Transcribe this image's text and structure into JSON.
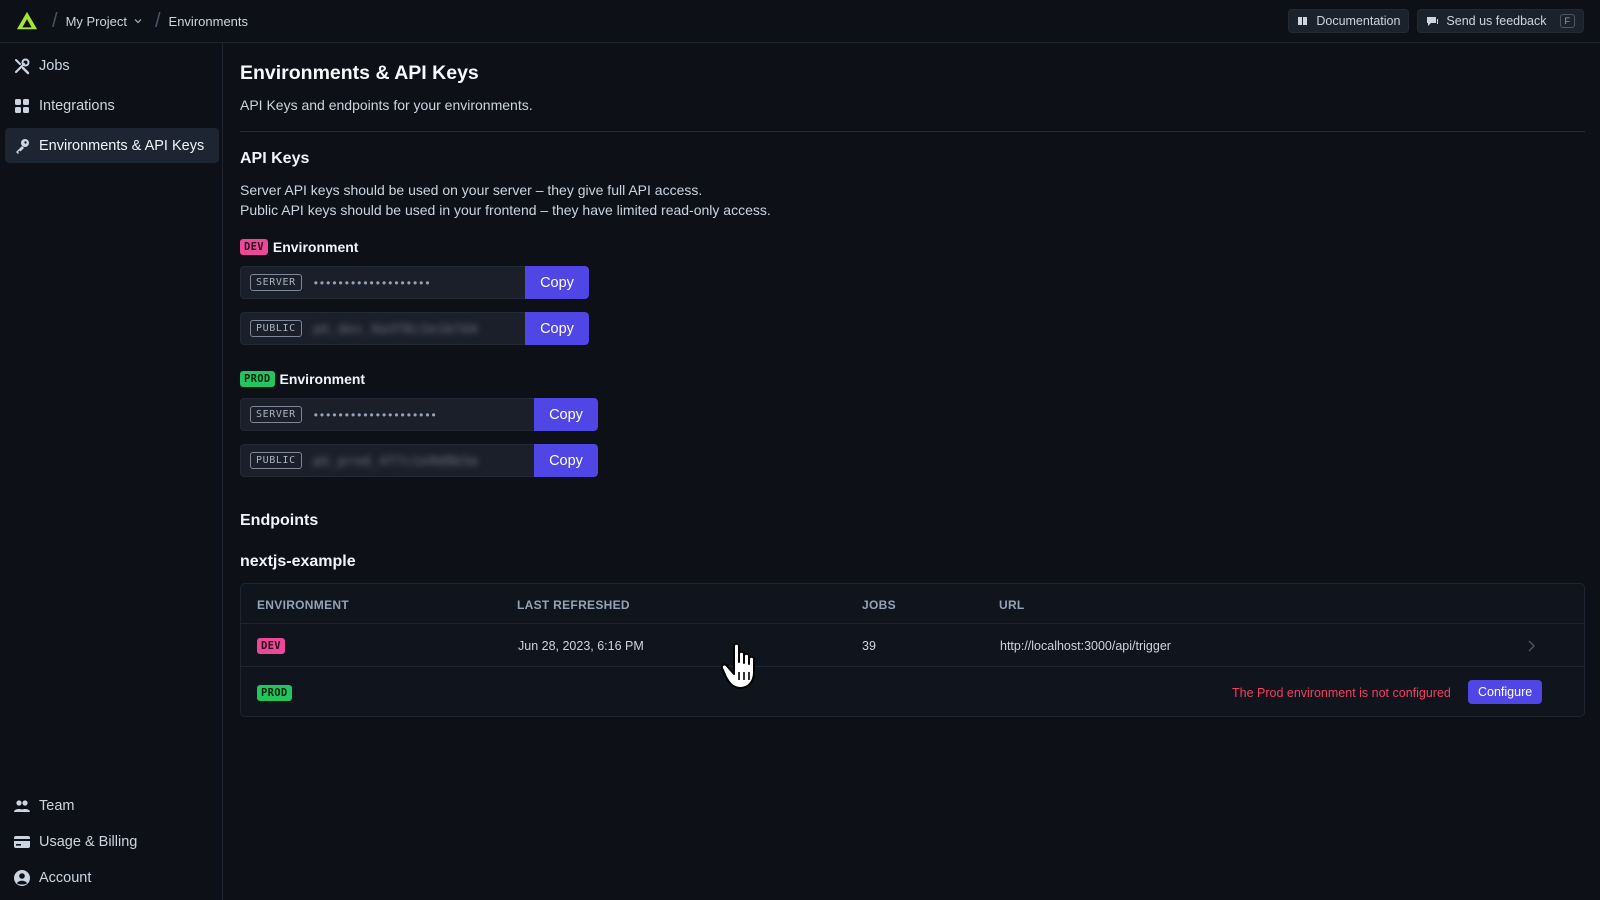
{
  "topbar": {
    "project": "My Project",
    "page": "Environments",
    "documentation": "Documentation",
    "feedback": "Send us feedback",
    "feedback_shortcut": "F"
  },
  "sidebar": {
    "items": [
      {
        "label": "Jobs",
        "icon": "tools-icon"
      },
      {
        "label": "Integrations",
        "icon": "grid-icon"
      },
      {
        "label": "Environments & API Keys",
        "icon": "key-icon",
        "active": true
      }
    ],
    "bottom_items": [
      {
        "label": "Team",
        "icon": "users-icon"
      },
      {
        "label": "Usage & Billing",
        "icon": "credit-card-icon"
      },
      {
        "label": "Account",
        "icon": "user-circle-icon"
      }
    ]
  },
  "main": {
    "title": "Environments & API Keys",
    "subtitle": "API Keys and endpoints for your environments.",
    "api_keys": {
      "heading": "API Keys",
      "desc1": "Server API keys should be used on your server – they give full API access.",
      "desc2": "Public API keys should be used in your frontend – they have limited read-only access.",
      "environment_label": "Environment",
      "dev": {
        "badge": "DEV",
        "server_tag": "SERVER",
        "server_value": "•••••••••••••••••••",
        "public_tag": "PUBLIC",
        "public_value": "pk_dev_9a3f8c2e1b7d4",
        "copy": "Copy"
      },
      "prod": {
        "badge": "PROD",
        "server_tag": "SERVER",
        "server_value": "••••••••••••••••••••",
        "public_tag": "PUBLIC",
        "public_value": "pk_prod_4f7c1e9d8b3a",
        "copy": "Copy"
      }
    },
    "endpoints": {
      "heading": "Endpoints",
      "project_name": "nextjs-example",
      "columns": [
        "ENVIRONMENT",
        "LAST REFRESHED",
        "JOBS",
        "URL"
      ],
      "rows": [
        {
          "env": "DEV",
          "last_refreshed": "Jun 28, 2023, 6:16 PM",
          "jobs": "39",
          "url": "http://localhost:3000/api/trigger"
        },
        {
          "env": "PROD",
          "warning": "The Prod environment is not configured",
          "action": "Configure"
        }
      ]
    }
  },
  "colors": {
    "accent": "#4f46e5",
    "dev_badge": "#ec4899",
    "prod_badge": "#22c55e",
    "warning": "#f43f5e",
    "background": "#0d1017"
  }
}
